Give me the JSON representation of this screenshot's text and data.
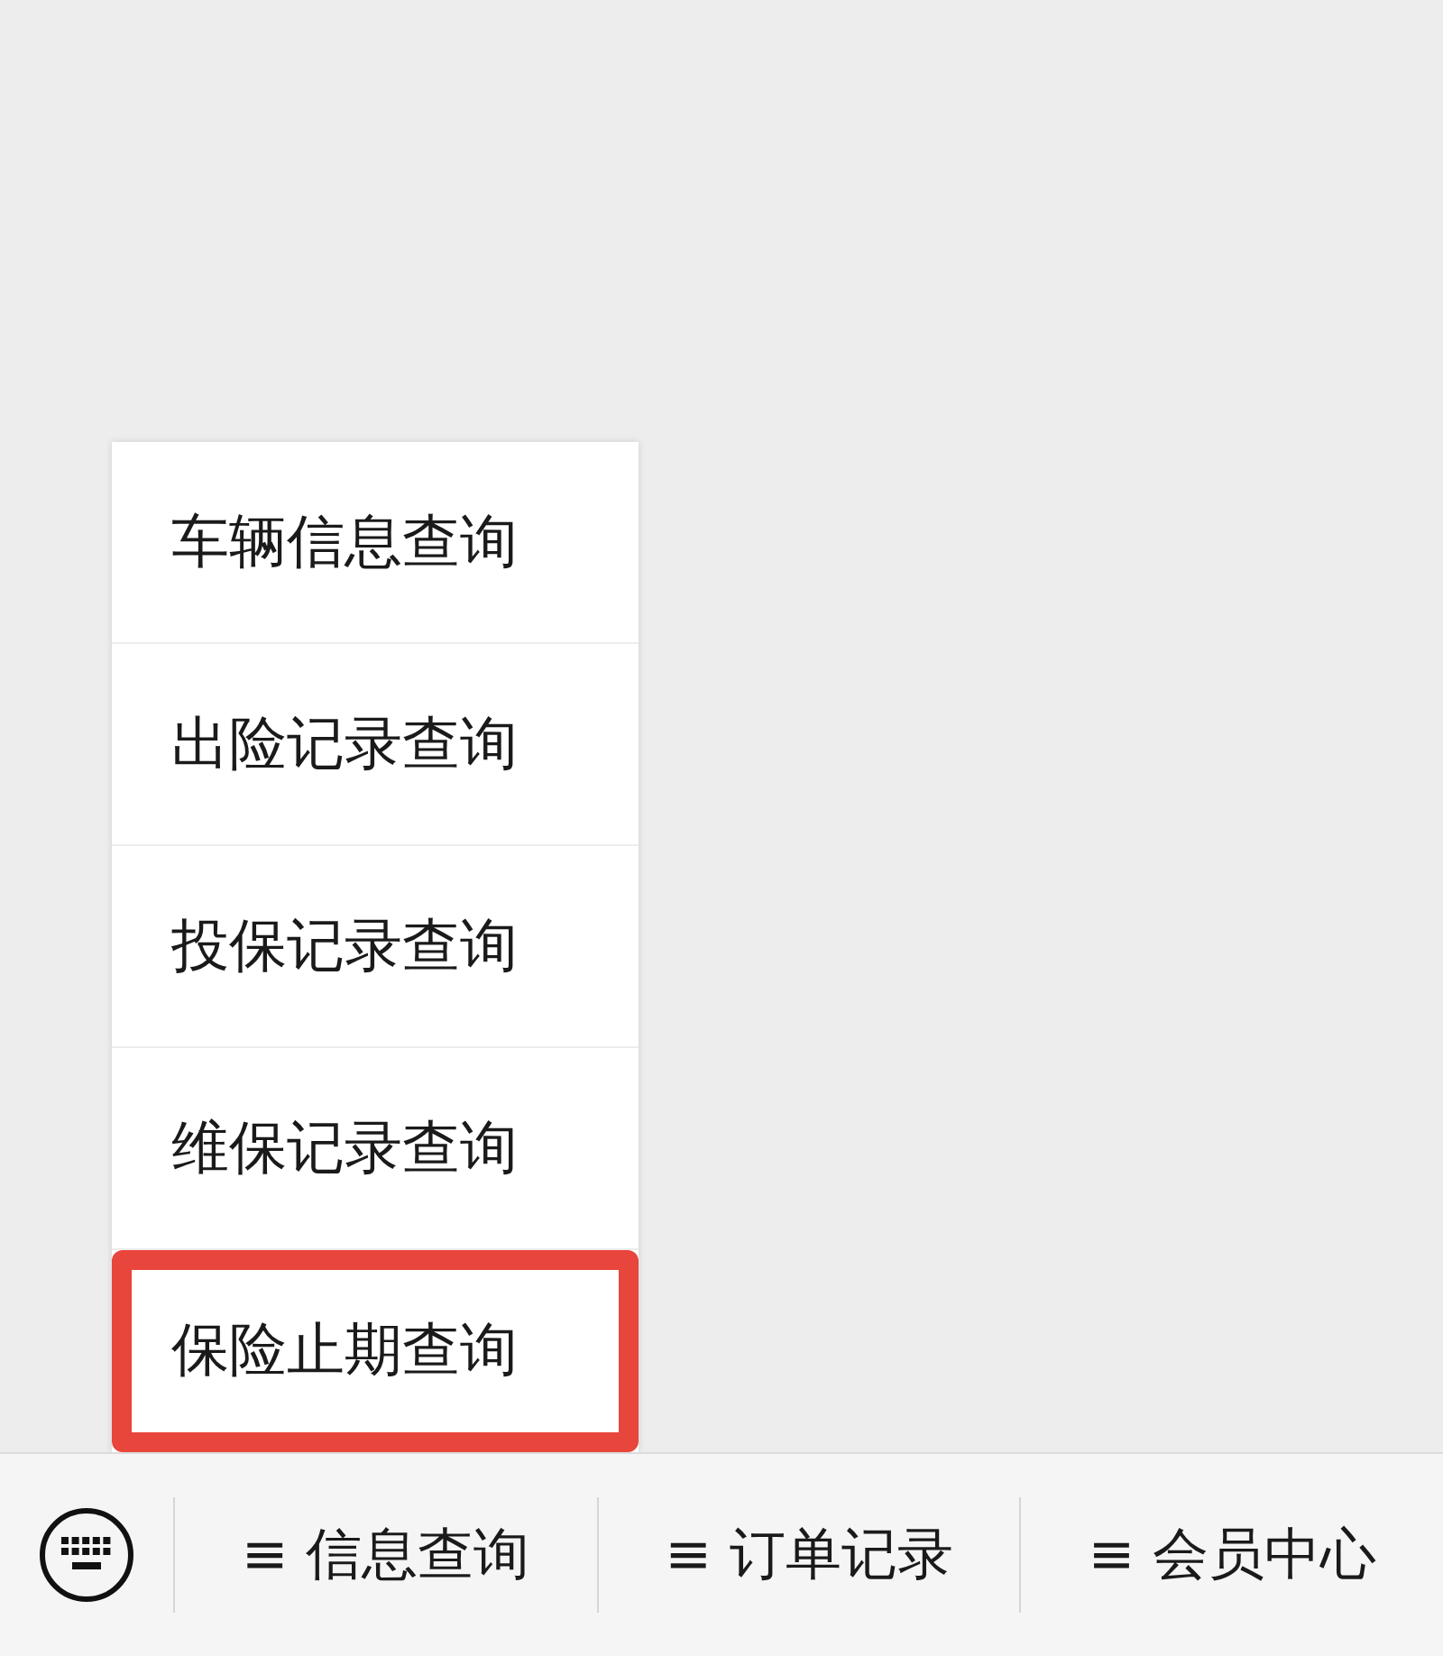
{
  "submenu": {
    "items": [
      {
        "label": "车辆信息查询",
        "highlighted": false
      },
      {
        "label": "出险记录查询",
        "highlighted": false
      },
      {
        "label": "投保记录查询",
        "highlighted": false
      },
      {
        "label": "维保记录查询",
        "highlighted": false
      },
      {
        "label": "保险止期查询",
        "highlighted": true
      }
    ]
  },
  "menu_bar": {
    "items": [
      {
        "icon": "≡",
        "label": "信息查询"
      },
      {
        "icon": "≡",
        "label": "订单记录"
      },
      {
        "icon": "≡",
        "label": "会员中心"
      }
    ]
  }
}
